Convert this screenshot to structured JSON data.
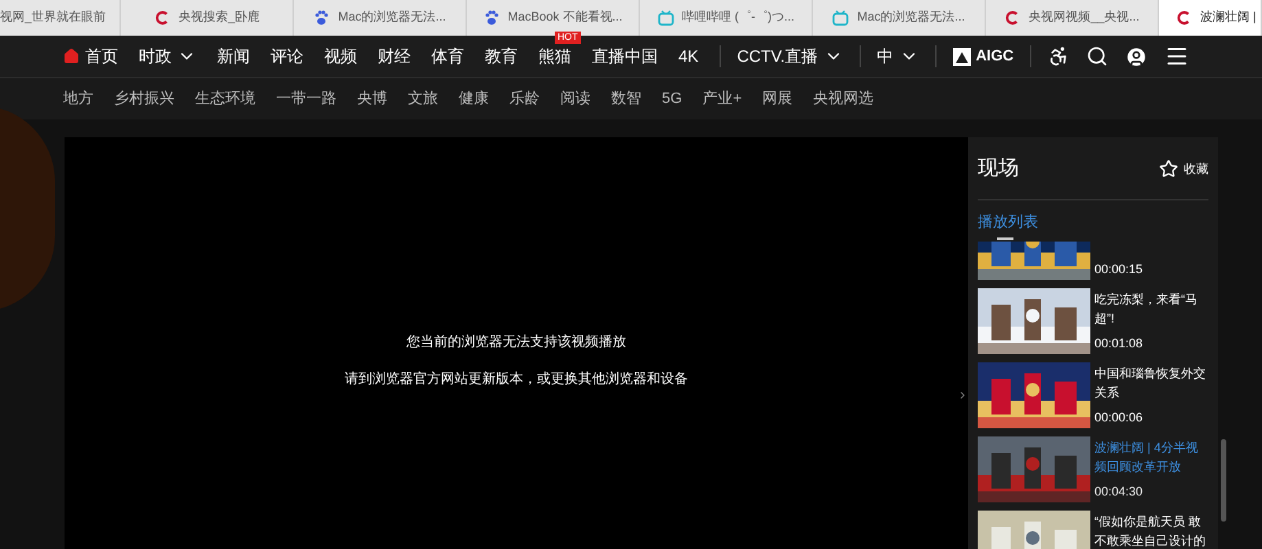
{
  "browser_tabs": [
    {
      "kind": "none",
      "title": "视网_世界就在眼前",
      "selected": false
    },
    {
      "kind": "cctv",
      "title": "央视搜索_卧鹿",
      "selected": false
    },
    {
      "kind": "paw",
      "title": "Mac的浏览器无法...",
      "selected": false
    },
    {
      "kind": "paw",
      "title": "MacBook 不能看视...",
      "selected": false
    },
    {
      "kind": "tv",
      "title": "哔哩哔哩 (゜-゜)つ...",
      "selected": false
    },
    {
      "kind": "tv",
      "title": "Mac的浏览器无法...",
      "selected": false
    },
    {
      "kind": "cctv",
      "title": "央视网视频__央视...",
      "selected": false
    },
    {
      "kind": "cctv",
      "title": "波澜壮阔 |",
      "selected": true
    }
  ],
  "nav": {
    "items": [
      {
        "label": "首页",
        "kind": "home"
      },
      {
        "label": "时政",
        "kind": "dropdown"
      },
      {
        "label": "新闻",
        "kind": "plain"
      },
      {
        "label": "评论",
        "kind": "plain"
      },
      {
        "label": "视频",
        "kind": "plain"
      },
      {
        "label": "财经",
        "kind": "plain"
      },
      {
        "label": "体育",
        "kind": "plain"
      },
      {
        "label": "教育",
        "kind": "plain"
      },
      {
        "label": "熊猫",
        "kind": "hot",
        "badge": "HOT"
      },
      {
        "label": "直播中国",
        "kind": "plain"
      },
      {
        "label": "4K",
        "kind": "plain"
      }
    ],
    "live": "CCTV.直播",
    "language": "中",
    "aigc": "AIGC"
  },
  "subnav": [
    "地方",
    "乡村振兴",
    "生态环境",
    "一带一路",
    "央博",
    "文旅",
    "健康",
    "乐龄",
    "阅读",
    "数智",
    "5G",
    "产业+",
    "网展",
    "央视网选"
  ],
  "player": {
    "messages": [
      "您当前的浏览器无法支持该视频播放",
      "请到浏览器官方网站更新版本，或更换其他浏览器和设备"
    ]
  },
  "sidebar": {
    "title": "现场",
    "favorite": "收藏",
    "tab": "播放列表",
    "playlist": [
      {
        "duration": "00:00:15",
        "selected": false
      },
      {
        "title": "吃完冻梨，来看“马超”!",
        "duration": "00:01:08",
        "selected": false
      },
      {
        "title": "中国和瑙鲁恢复外交关系",
        "duration": "00:00:06",
        "selected": false
      },
      {
        "title": "波澜壮阔 | 4分半视频回顾改革开放",
        "duration": "00:04:30",
        "selected": true
      },
      {
        "title": "“假如你是航天员 敢不敢乘坐自己设计的",
        "selected": false
      }
    ]
  }
}
